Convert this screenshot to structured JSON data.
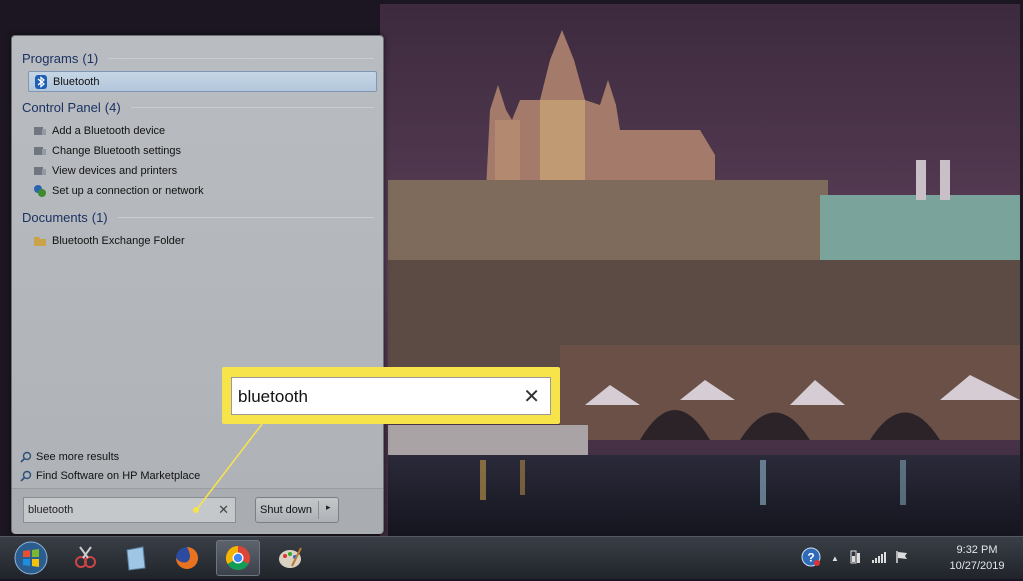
{
  "start_menu": {
    "groups": [
      {
        "title": "Programs",
        "count": "(1)",
        "items": [
          {
            "label": "Bluetooth",
            "icon": "bluetooth-icon"
          }
        ]
      },
      {
        "title": "Control Panel",
        "count": "(4)",
        "items": [
          {
            "label": "Add a Bluetooth device",
            "icon": "device-icon"
          },
          {
            "label": "Change Bluetooth settings",
            "icon": "device-icon"
          },
          {
            "label": "View devices and printers",
            "icon": "device-icon"
          },
          {
            "label": "Set up a connection or network",
            "icon": "network-icon"
          }
        ]
      },
      {
        "title": "Documents",
        "count": "(1)",
        "items": [
          {
            "label": "Bluetooth Exchange Folder",
            "icon": "folder-icon"
          }
        ]
      }
    ],
    "see_more": "See more results",
    "find_software": "Find Software on HP Marketplace",
    "search": {
      "value": "bluetooth",
      "clear": "✕"
    },
    "shutdown_label": "Shut down",
    "shutdown_arrow": "▸"
  },
  "callout": {
    "value": "bluetooth",
    "clear": "✕"
  },
  "taskbar": {
    "pinned": [
      "snipping-tool-icon",
      "notepad-icon",
      "firefox-icon",
      "chrome-icon",
      "paint-icon"
    ],
    "active": "chrome-icon",
    "tray_up": "▲",
    "clock_time": "9:32 PM",
    "clock_date": "10/27/2019"
  },
  "colors": {
    "callout": "#f7e44a",
    "menu_bg": "#b9bcc0",
    "header_text": "#1b3263"
  }
}
